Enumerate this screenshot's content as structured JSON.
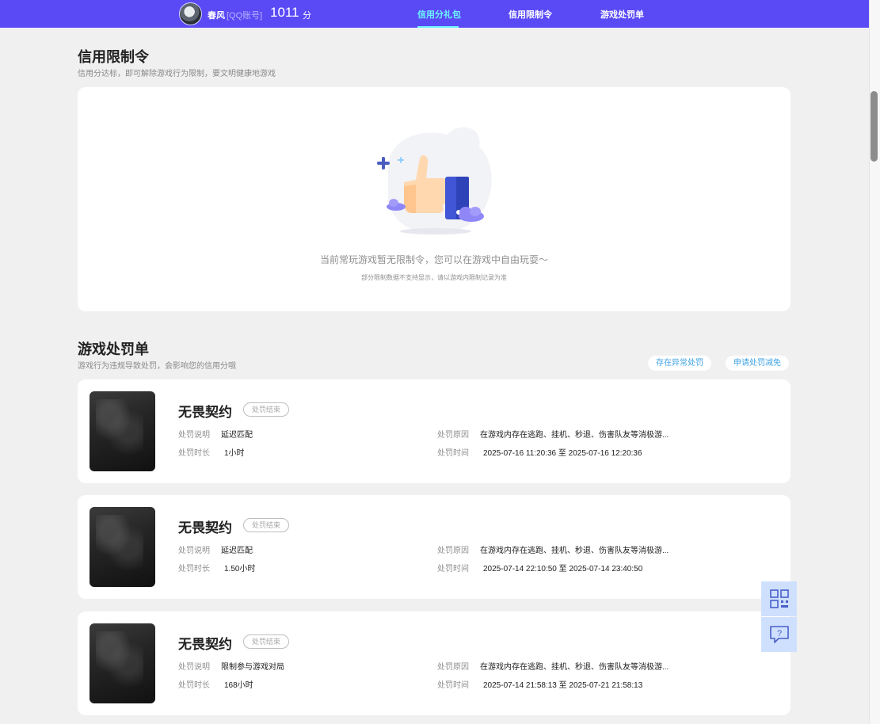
{
  "header": {
    "username": "春风",
    "account_type": "[QQ账号]",
    "score": "1011",
    "score_unit": "分",
    "tabs": [
      {
        "label": "信用分礼包",
        "active": true
      },
      {
        "label": "信用限制令",
        "active": false
      },
      {
        "label": "游戏处罚单",
        "active": false
      }
    ]
  },
  "restriction": {
    "title": "信用限制令",
    "subtitle": "信用分达标，即可解除游戏行为限制，要文明健康地游戏",
    "empty_message": "当前常玩游戏暂无限制令，您可以在游戏中自由玩耍～",
    "empty_note": "部分限制数据不支持显示，请以游戏内限制记录为准"
  },
  "penalty": {
    "title": "游戏处罚单",
    "subtitle": "游戏行为违规导致处罚，会影响您的信用分哦",
    "buttons": {
      "abnormal": "存在异常处罚",
      "reduce": "申请处罚减免"
    },
    "field_labels": {
      "description": "处罚说明",
      "duration": "处罚时长",
      "reason": "处罚原因",
      "time": "处罚时间"
    },
    "items": [
      {
        "game": "无畏契约",
        "status": "处罚结束",
        "description": "延迟匹配",
        "duration": "1小时",
        "reason": "在游戏内存在逃跑、挂机、秒退、伤害队友等消极游...",
        "time": "2025-07-16 11:20:36 至 2025-07-16 12:20:36"
      },
      {
        "game": "无畏契约",
        "status": "处罚结束",
        "description": "延迟匹配",
        "duration": "1.50小时",
        "reason": "在游戏内存在逃跑、挂机、秒退、伤害队友等消极游...",
        "time": "2025-07-14 22:10:50 至 2025-07-14 23:40:50"
      },
      {
        "game": "无畏契约",
        "status": "处罚结束",
        "description": "限制参与游戏对局",
        "duration": "168小时",
        "reason": "在游戏内存在逃跑、挂机、秒退、伤害队友等消极游...",
        "time": "2025-07-14 21:58:13 至 2025-07-21 21:58:13"
      }
    ]
  },
  "side_tools": [
    "qr-code-icon",
    "help-feedback-icon"
  ],
  "colors": {
    "header_bg": "#5a4af6",
    "active_tab": "#6ef2ff",
    "link_blue": "#3ea3e6",
    "page_bg": "#f0f0f0"
  }
}
